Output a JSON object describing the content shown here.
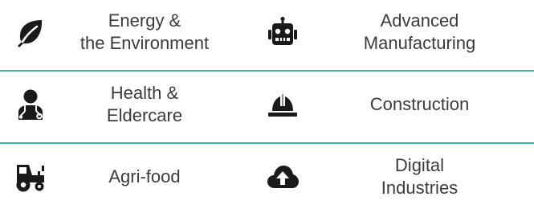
{
  "colors": {
    "divider": "#44b2ac",
    "icon": "#1a1a1a",
    "text": "#3b3b3b"
  },
  "sectors": [
    {
      "icon": "leaf-icon",
      "label": "Energy &\nthe Environment"
    },
    {
      "icon": "robot-icon",
      "label": "Advanced\nManufacturing"
    },
    {
      "icon": "doctor-icon",
      "label": "Health &\nEldercare"
    },
    {
      "icon": "hard-hat-icon",
      "label": "Construction"
    },
    {
      "icon": "tractor-icon",
      "label": "Agri-food"
    },
    {
      "icon": "cloud-upload-icon",
      "label": "Digital\nIndustries"
    }
  ]
}
